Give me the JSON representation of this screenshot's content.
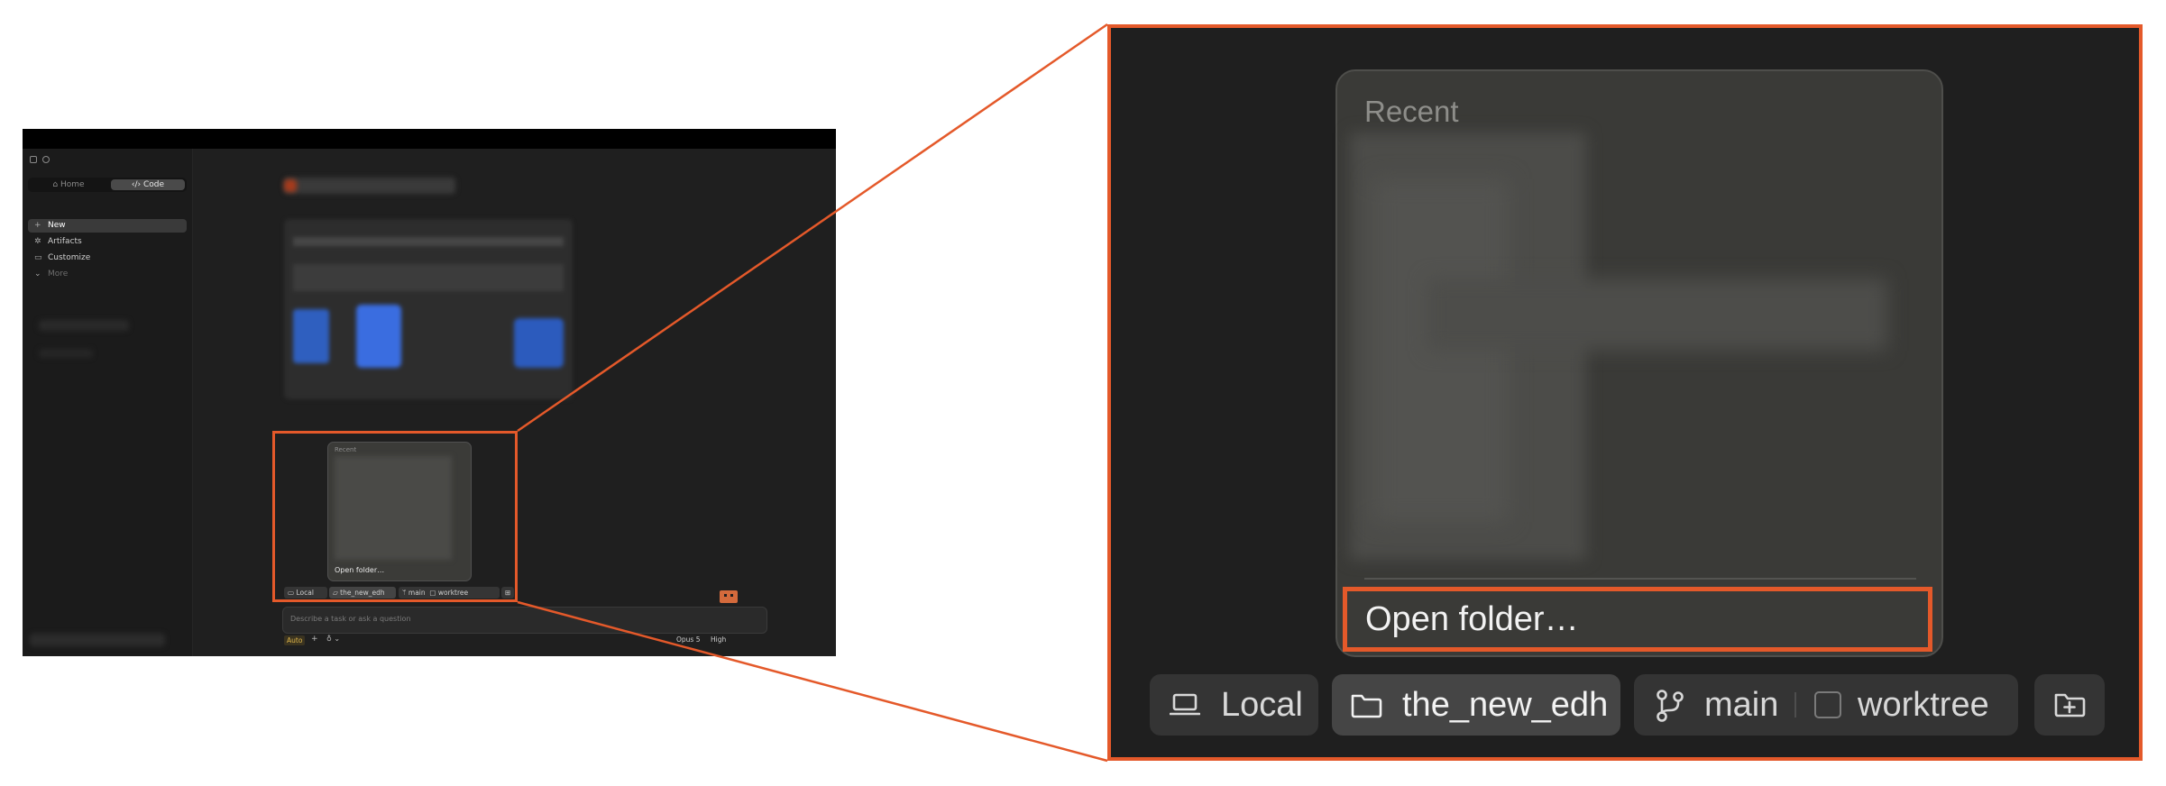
{
  "sidebar": {
    "switch": {
      "home_label": "Home",
      "code_label": "Code"
    },
    "items": [
      {
        "label": "New",
        "icon": "plus-icon"
      },
      {
        "label": "Artifacts",
        "icon": "artifacts-icon"
      },
      {
        "label": "Customize",
        "icon": "customize-icon"
      },
      {
        "label": "More",
        "icon": "chevron-down-icon"
      }
    ]
  },
  "popup": {
    "recent_label": "Recent",
    "open_folder_label": "Open folder…"
  },
  "toolbar": {
    "local_label": "Local",
    "folder_label": "the_new_edh",
    "branch_label": "main",
    "worktree_label": "worktree"
  },
  "composer": {
    "placeholder": "Describe a task or ask a question",
    "mode_label": "Auto",
    "model_label": "Opus 5",
    "effort_label": "High"
  },
  "colors": {
    "highlight": "#e4592a",
    "panel_bg": "#1f1f1f",
    "popup_bg": "#3a3a37"
  }
}
